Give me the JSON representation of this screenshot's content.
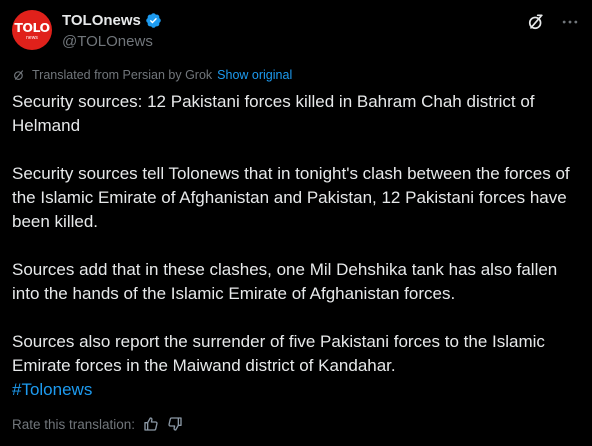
{
  "account": {
    "display_name": "TOLOnews",
    "handle": "@TOLOnews",
    "avatar_text": "TOLO",
    "avatar_subtext": "news",
    "verified": true
  },
  "icons": {
    "verified": "verified-badge-icon",
    "grok": "grok-icon",
    "more": "more-options-icon",
    "translate": "translate-icon",
    "thumbs_up": "thumbs-up-icon",
    "thumbs_down": "thumbs-down-icon"
  },
  "translation": {
    "label": "Translated from Persian by Grok",
    "show_original": "Show original"
  },
  "tweet": {
    "paragraphs": [
      "Security sources: 12 Pakistani forces killed in Bahram Chah district of Helmand",
      "Security sources tell Tolonews that in tonight's clash between the forces of the Islamic Emirate of Afghanistan and Pakistan, 12 Pakistani forces have been killed.",
      "Sources add that in these clashes, one Mil Dehshika tank has also fallen into the hands of the Islamic Emirate of Afghanistan forces.",
      "Sources also report the surrender of five Pakistani forces to the Islamic Emirate forces in the Maiwand district of Kandahar."
    ],
    "hashtag": "#Tolonews"
  },
  "rate": {
    "label": "Rate this translation:"
  },
  "colors": {
    "background": "#000000",
    "text": "#e7e9ea",
    "secondary": "#71767b",
    "accent": "#1d9bf0",
    "avatar": "#e0211b"
  }
}
